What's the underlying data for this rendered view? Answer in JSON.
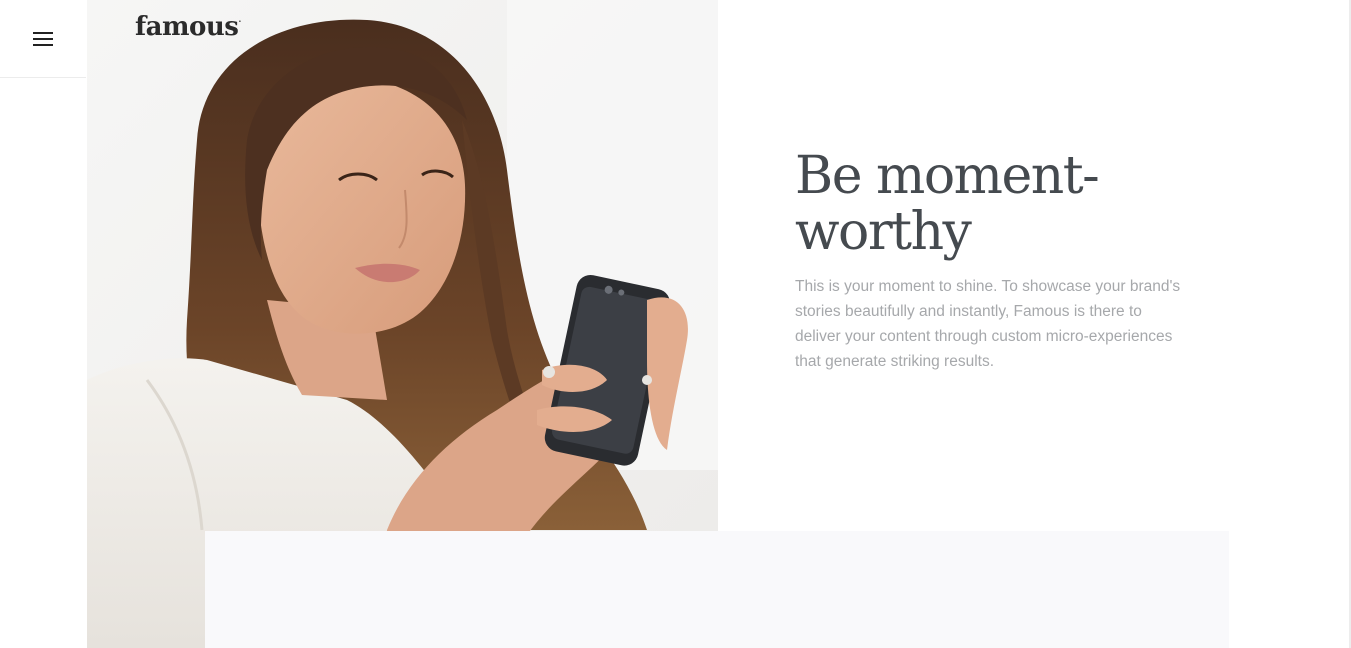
{
  "brand": {
    "logo_text": "famous",
    "logo_mark": "·"
  },
  "nav": {
    "menu_icon": "hamburger-menu-icon"
  },
  "hero": {
    "headline": "Be moment-worthy",
    "headline_line1": "Be moment-",
    "headline_line2": "worthy",
    "body": "This is your moment to shine. To showcase your brand's stories beautifully and instantly, Famous is there to deliver your content through custom micro-experiences that generate striking results.",
    "photo_alt_icon": "woman-with-phone-photo"
  },
  "colors": {
    "headline": "#454a4f",
    "body": "#a6a8ab",
    "card_bg": "#f9f9fb"
  }
}
